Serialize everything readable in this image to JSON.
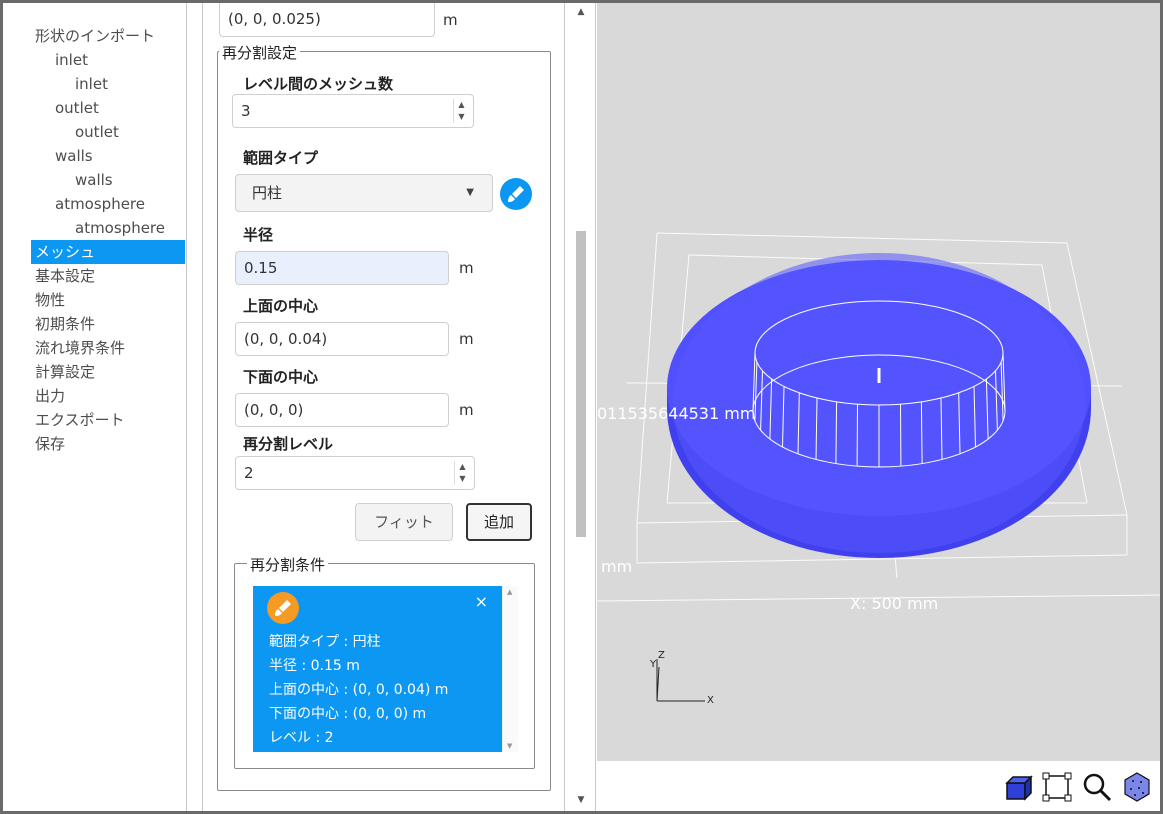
{
  "tree": {
    "items": [
      {
        "label": "形状のインポート",
        "level": 0,
        "selected": false
      },
      {
        "label": "inlet",
        "level": 1,
        "selected": false
      },
      {
        "label": "inlet",
        "level": 2,
        "selected": false
      },
      {
        "label": "outlet",
        "level": 1,
        "selected": false
      },
      {
        "label": "outlet",
        "level": 2,
        "selected": false
      },
      {
        "label": "walls",
        "level": 1,
        "selected": false
      },
      {
        "label": "walls",
        "level": 2,
        "selected": false
      },
      {
        "label": "atmosphere",
        "level": 1,
        "selected": false
      },
      {
        "label": "atmosphere",
        "level": 2,
        "selected": false
      },
      {
        "label": "メッシュ",
        "level": 0,
        "selected": true
      },
      {
        "label": "基本設定",
        "level": 0,
        "selected": false
      },
      {
        "label": "物性",
        "level": 0,
        "selected": false
      },
      {
        "label": "初期条件",
        "level": 0,
        "selected": false
      },
      {
        "label": "流れ境界条件",
        "level": 0,
        "selected": false
      },
      {
        "label": "計算設定",
        "level": 0,
        "selected": false
      },
      {
        "label": "出力",
        "level": 0,
        "selected": false
      },
      {
        "label": "エクスポート",
        "level": 0,
        "selected": false
      },
      {
        "label": "保存",
        "level": 0,
        "selected": false
      }
    ]
  },
  "settings": {
    "top_field": {
      "value": "(0, 0, 0.025)",
      "unit": "m"
    },
    "refinement_group": {
      "legend": "再分割設定",
      "mesh_between_levels": {
        "label": "レベル間のメッシュ数",
        "value": "3"
      },
      "range_type": {
        "label": "範囲タイプ",
        "value": "円柱"
      },
      "radius": {
        "label": "半径",
        "value": "0.15",
        "unit": "m"
      },
      "top_center": {
        "label": "上面の中心",
        "value": "(0, 0, 0.04)",
        "unit": "m"
      },
      "bottom_center": {
        "label": "下面の中心",
        "value": "(0, 0, 0)",
        "unit": "m"
      },
      "refine_level": {
        "label": "再分割レベル",
        "value": "2"
      },
      "fit_button": "フィット",
      "add_button": "追加"
    },
    "conditions_group": {
      "legend": "再分割条件",
      "card": {
        "close": "×",
        "lines": [
          "範囲タイプ : 円柱",
          "半径 : 0.15 m",
          "上面の中心 : (0, 0, 0.04) m",
          "下面の中心 : (0, 0, 0) m",
          "レベル : 2"
        ]
      }
    }
  },
  "viewport": {
    "labels": {
      "y_dim": "0115356445 31 mm",
      "y_dim_text": "011535644531 mm",
      "left_mm": "mm",
      "x_dim": "X: 500 mm",
      "axis_x": "X",
      "axis_y": "Y",
      "axis_z": "Z"
    },
    "colors": {
      "disc": "#4a4aff",
      "background": "#d9d9d9",
      "accent": "#0b97f2"
    }
  },
  "toolbar": {
    "icons": [
      "cube-view-icon",
      "fit-frame-icon",
      "zoom-icon",
      "mesh-display-icon"
    ]
  }
}
